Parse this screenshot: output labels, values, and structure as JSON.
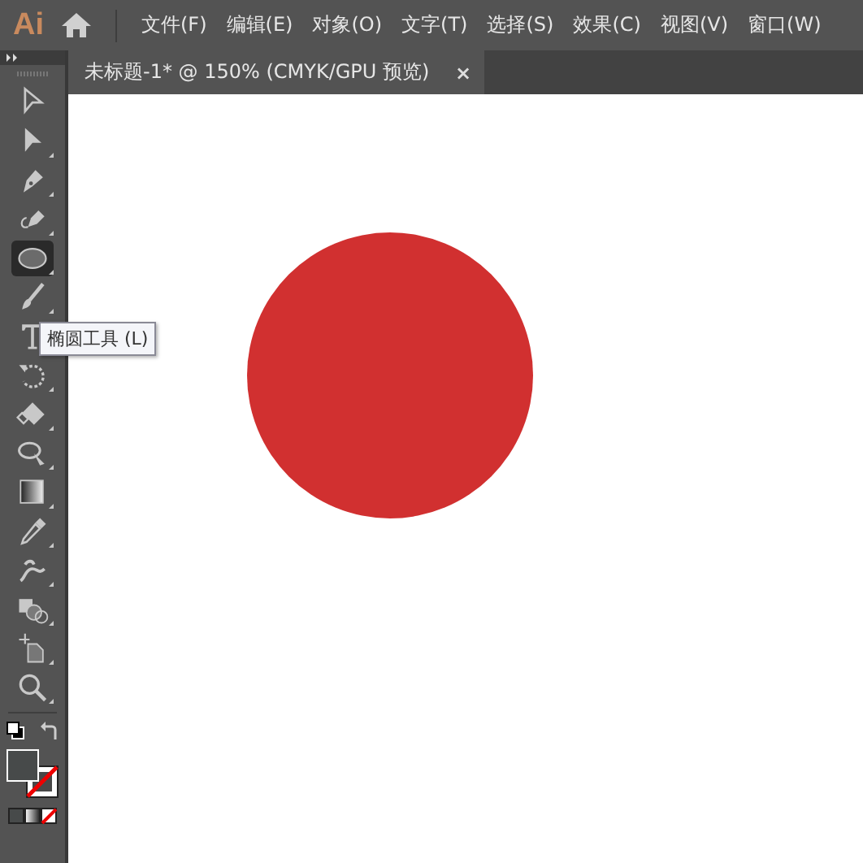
{
  "app": {
    "logo": "Ai"
  },
  "menu": [
    {
      "label": "文件(F)"
    },
    {
      "label": "编辑(E)"
    },
    {
      "label": "对象(O)"
    },
    {
      "label": "文字(T)"
    },
    {
      "label": "选择(S)"
    },
    {
      "label": "效果(C)"
    },
    {
      "label": "视图(V)"
    },
    {
      "label": "窗口(W)"
    }
  ],
  "document_tab": {
    "title": "未标题-1* @ 150% (CMYK/GPU 预览)",
    "close": "×"
  },
  "tools": [
    {
      "selected": false
    },
    {
      "selected": false
    },
    {
      "selected": false
    },
    {
      "selected": false
    },
    {
      "selected": true
    },
    {
      "selected": false
    },
    {
      "selected": false
    },
    {
      "selected": false
    },
    {
      "selected": false
    },
    {
      "selected": false
    },
    {
      "selected": false
    },
    {
      "selected": false
    },
    {
      "selected": false
    },
    {
      "selected": false
    },
    {
      "selected": false
    },
    {
      "selected": false
    }
  ],
  "tooltip": {
    "text": "椭圆工具 (L)"
  },
  "canvas": {
    "shapes": [
      {
        "kind": "circle",
        "color": "#d13030"
      }
    ]
  }
}
